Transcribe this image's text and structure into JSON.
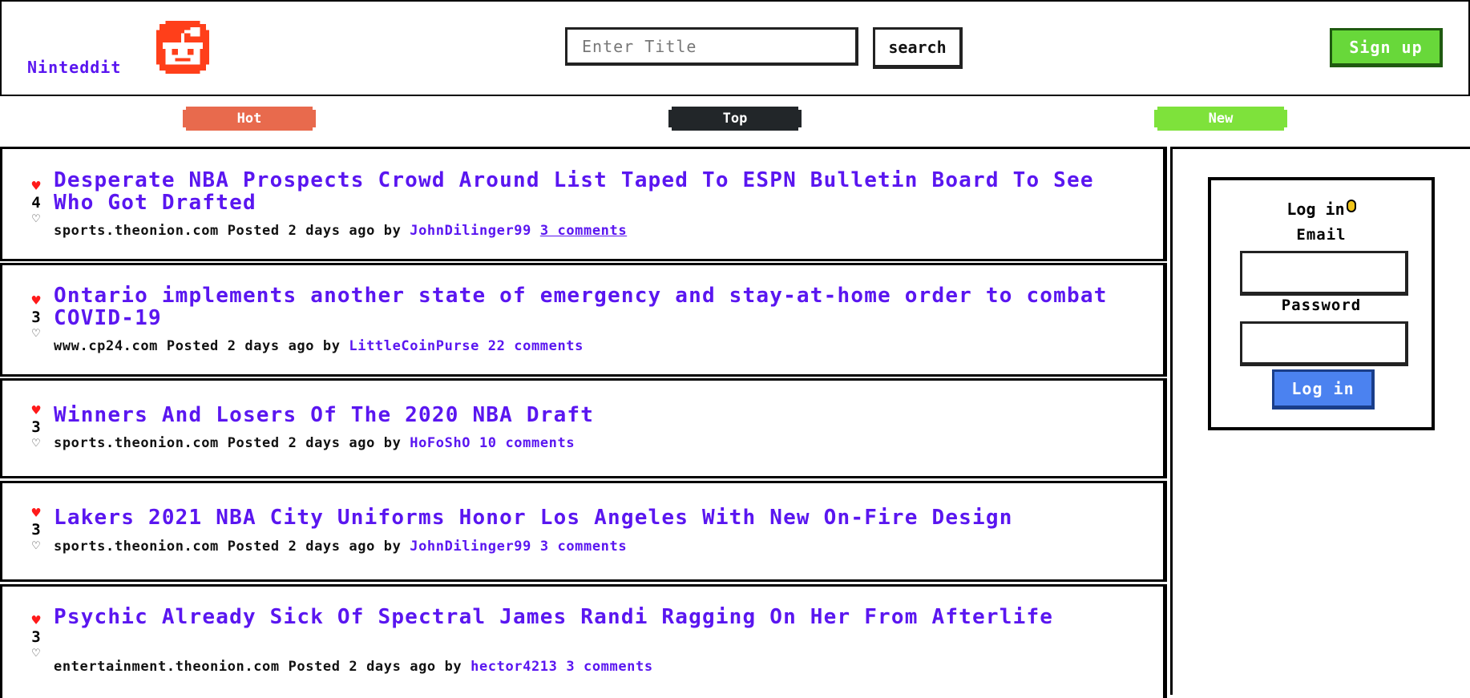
{
  "header": {
    "brand": "Ninteddit",
    "search_placeholder": "Enter Title",
    "search_value": "",
    "search_button": "search",
    "signup_button": "Sign up"
  },
  "tabs": [
    {
      "label": "Hot",
      "color": "#e86a4d"
    },
    {
      "label": "Top",
      "color": "#222629"
    },
    {
      "label": "New",
      "color": "#7ee23b"
    }
  ],
  "posts": [
    {
      "score": "4",
      "title": "Desperate NBA Prospects Crowd Around List Taped To ESPN Bulletin Board To See Who Got Drafted",
      "domain": "sports.theonion.com",
      "posted": "Posted 2 days ago by",
      "user": "JohnDilinger99",
      "comments": "3 comments"
    },
    {
      "score": "3",
      "title": "Ontario implements another state of emergency and stay-at-home order to combat COVID-19",
      "domain": "www.cp24.com",
      "posted": "Posted 2 days ago by",
      "user": "LittleCoinPurse",
      "comments": "22 comments"
    },
    {
      "score": "3",
      "title": "Winners And Losers Of The 2020 NBA Draft",
      "domain": "sports.theonion.com",
      "posted": "Posted 2 days ago by",
      "user": "HoFoShO",
      "comments": "10 comments"
    },
    {
      "score": "3",
      "title": "Lakers 2021 NBA City Uniforms Honor Los Angeles With New On-Fire Design",
      "domain": "sports.theonion.com",
      "posted": "Posted 2 days ago by",
      "user": "JohnDilinger99",
      "comments": "3 comments"
    },
    {
      "score": "3",
      "title": "Psychic Already Sick Of Spectral James Randi Ragging On Her From Afterlife",
      "domain": "entertainment.theonion.com",
      "posted": "Posted 2 days ago by",
      "user": "hector4213",
      "comments": "3 comments"
    }
  ],
  "login": {
    "title": "Log in",
    "email_label": "Email",
    "email_value": "",
    "password_label": "Password",
    "password_value": "",
    "button": "Log in"
  },
  "colors": {
    "link": "#5a16f0",
    "heart": "#ff1a1a",
    "signup": "#68d83a",
    "login_button": "#4b82f0"
  }
}
